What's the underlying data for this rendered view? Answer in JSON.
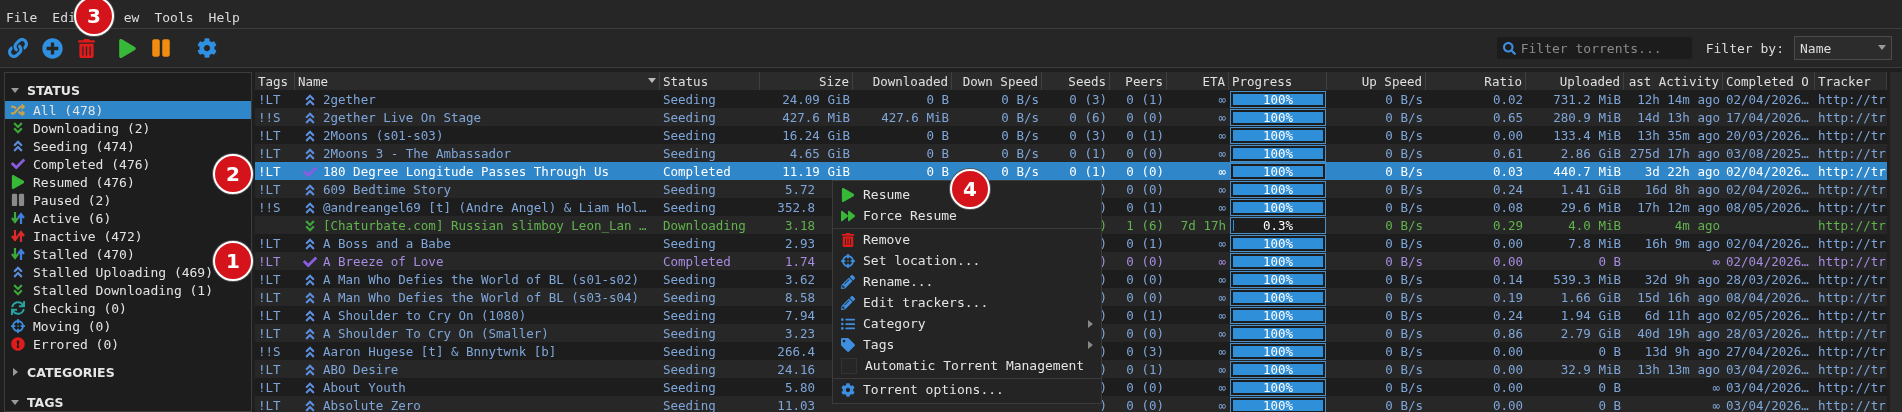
{
  "menu_bar": [
    {
      "label": "File"
    },
    {
      "label": "Edi"
    },
    {
      "label": "ew"
    },
    {
      "label": "Tools"
    },
    {
      "label": "Help"
    }
  ],
  "toolbar": {
    "buttons": [
      {
        "kind": "link"
      },
      {
        "kind": "add"
      },
      {
        "kind": "delete"
      },
      {
        "kind": "play"
      },
      {
        "kind": "pause"
      },
      {
        "kind": "settings"
      }
    ],
    "search": {
      "placeholder": "Filter torrents..."
    },
    "filter_label": "Filter by:",
    "filter_value": "Name"
  },
  "sidebar": {
    "sections": [
      {
        "title": "STATUS",
        "expanded": true,
        "items": [
          {
            "label": "All (478)",
            "kind": "all",
            "selected": true
          },
          {
            "label": "Downloading (2)",
            "kind": "downloading",
            "selected": false
          },
          {
            "label": "Seeding (474)",
            "kind": "seeding",
            "selected": false
          },
          {
            "label": "Completed (476)",
            "kind": "completed",
            "selected": false
          },
          {
            "label": "Resumed (476)",
            "kind": "resumed",
            "selected": false
          },
          {
            "label": "Paused (2)",
            "kind": "paused",
            "selected": false
          },
          {
            "label": "Active (6)",
            "kind": "active",
            "selected": false
          },
          {
            "label": "Inactive (472)",
            "kind": "inactive",
            "selected": false
          },
          {
            "label": "Stalled (470)",
            "kind": "stalled",
            "selected": false
          },
          {
            "label": "Stalled Uploading (469)",
            "kind": "stalledup",
            "selected": false
          },
          {
            "label": "Stalled Downloading (1)",
            "kind": "stalleddown",
            "selected": false
          },
          {
            "label": "Checking (0)",
            "kind": "checking",
            "selected": false
          },
          {
            "label": "Moving (0)",
            "kind": "moving",
            "selected": false
          },
          {
            "label": "Errored (0)",
            "kind": "errored",
            "selected": false
          }
        ]
      },
      {
        "title": "CATEGORIES",
        "expanded": false
      },
      {
        "title": "TAGS",
        "expanded": true
      }
    ]
  },
  "table": {
    "columns": [
      "Tags",
      "Name",
      "Status",
      "Size",
      "Downloaded",
      "Down Speed",
      "Seeds",
      "Peers",
      "ETA",
      "Progress",
      "Up Speed",
      "Ratio",
      "Uploaded",
      "ast Activity",
      "Completed O",
      "Tracker"
    ],
    "rows": [
      {
        "tags": "!LT",
        "name": "2gether",
        "status": "Seeding",
        "kind": "seeding",
        "selected": false,
        "size": "24.09 GiB",
        "downloaded": "0 B",
        "down_speed": "0 B/s",
        "seeds": "0 (3)",
        "peers": "0 (1)",
        "eta": "∞",
        "progress": "100%",
        "level": 1,
        "up_speed": "0 B/s",
        "ratio": "0.02",
        "uploaded": "731.2 MiB",
        "last_activity": "12h 14m ago",
        "completed_on": "02/04/2026…",
        "tracker": "http://tr"
      },
      {
        "tags": "!!S",
        "name": "2gether Live On Stage",
        "status": "Seeding",
        "kind": "seeding",
        "selected": false,
        "size": "427.6 MiB",
        "downloaded": "427.6 MiB",
        "down_speed": "0 B/s",
        "seeds": "0 (6)",
        "peers": "0 (0)",
        "eta": "∞",
        "progress": "100%",
        "level": 1,
        "up_speed": "0 B/s",
        "ratio": "0.65",
        "uploaded": "280.9 MiB",
        "last_activity": "14d 13h ago",
        "completed_on": "17/04/2026…",
        "tracker": "http://tr"
      },
      {
        "tags": "!LT",
        "name": "2Moons (s01-s03)",
        "status": "Seeding",
        "kind": "seeding",
        "selected": false,
        "size": "16.24 GiB",
        "downloaded": "0 B",
        "down_speed": "0 B/s",
        "seeds": "0 (3)",
        "peers": "0 (1)",
        "eta": "∞",
        "progress": "100%",
        "level": 1,
        "up_speed": "0 B/s",
        "ratio": "0.00",
        "uploaded": "133.4 MiB",
        "last_activity": "13h 35m ago",
        "completed_on": "20/03/2026…",
        "tracker": "http://tr"
      },
      {
        "tags": "!LT",
        "name": "2Moons 3 - The Ambassador",
        "status": "Seeding",
        "kind": "seeding",
        "selected": false,
        "size": "4.65 GiB",
        "downloaded": "0 B",
        "down_speed": "0 B/s",
        "seeds": "0 (1)",
        "peers": "0 (0)",
        "eta": "∞",
        "progress": "100%",
        "level": 1,
        "up_speed": "0 B/s",
        "ratio": "0.61",
        "uploaded": "2.86 GiB",
        "last_activity": "275d 17h ago",
        "completed_on": "03/08/2025…",
        "tracker": "http://tr"
      },
      {
        "tags": "!LT",
        "name": "180 Degree Longitude Passes Through Us",
        "status": "Completed",
        "kind": "completed",
        "selected": true,
        "size": "11.19 GiB",
        "downloaded": "0 B",
        "down_speed": "0 B/s",
        "seeds": "0 (1)",
        "peers": "0 (0)",
        "eta": "∞",
        "progress": "100%",
        "level": 1,
        "up_speed": "0 B/s",
        "ratio": "0.03",
        "uploaded": "440.7 MiB",
        "last_activity": "3d 22h ago",
        "completed_on": "02/04/2026…",
        "tracker": "http://tr"
      },
      {
        "tags": "!LT",
        "name": "609 Bedtime Story",
        "status": "Seeding",
        "kind": "seeding",
        "selected": false,
        "size": "5.72",
        "seeds": ")",
        "peers": "0 (0)",
        "eta": "∞",
        "progress": "100%",
        "level": 1,
        "up_speed": "0 B/s",
        "ratio": "0.24",
        "uploaded": "1.41 GiB",
        "last_activity": "16d 8h ago",
        "completed_on": "02/04/2026…",
        "tracker": "http://tr"
      },
      {
        "tags": "!!S",
        "name": "@andreangel69 [t] (Andre Angel) & Liam Hol…",
        "status": "Seeding",
        "kind": "seeding",
        "selected": false,
        "size": "352.8",
        "seeds": ")",
        "peers": "0 (1)",
        "eta": "∞",
        "progress": "100%",
        "level": 1,
        "up_speed": "0 B/s",
        "ratio": "0.08",
        "uploaded": "29.6 MiB",
        "last_activity": "17h 12m ago",
        "completed_on": "08/05/2026…",
        "tracker": "http://tr"
      },
      {
        "name": "[Chaturbate.com] Russian slimboy Leon_Lan …",
        "status": "Downloading",
        "kind": "downloading",
        "selected": false,
        "size": "3.18",
        "seeds": ")",
        "peers": "1 (6)",
        "eta": "7d 17h",
        "progress": "0.3%",
        "level": 0.003,
        "up_speed": "0 B/s",
        "ratio": "0.29",
        "uploaded": "4.0 MiB",
        "last_activity": "4m ago",
        "tracker": "http://tr"
      },
      {
        "tags": "!LT",
        "name": "A Boss and a Babe",
        "status": "Seeding",
        "kind": "seeding",
        "selected": false,
        "size": "2.93",
        "seeds": ")",
        "peers": "0 (1)",
        "eta": "∞",
        "progress": "100%",
        "level": 1,
        "up_speed": "0 B/s",
        "ratio": "0.00",
        "uploaded": "7.8 MiB",
        "last_activity": "16h 9m ago",
        "completed_on": "02/04/2026…",
        "tracker": "http://tr"
      },
      {
        "tags": "!LT",
        "name": "A Breeze of Love",
        "status": "Completed",
        "kind": "completed",
        "selected": false,
        "size": "1.74",
        "seeds": ")",
        "peers": "0 (0)",
        "eta": "∞",
        "progress": "100%",
        "level": 1,
        "up_speed": "0 B/s",
        "ratio": "0.00",
        "uploaded": "0 B",
        "last_activity": "∞",
        "completed_on": "02/04/2026…",
        "tracker": "http://tr"
      },
      {
        "tags": "!LT",
        "name": "A Man Who Defies the World of BL (s01-s02)",
        "status": "Seeding",
        "kind": "seeding",
        "selected": false,
        "size": "3.62",
        "seeds": ")",
        "peers": "0 (0)",
        "eta": "∞",
        "progress": "100%",
        "level": 1,
        "up_speed": "0 B/s",
        "ratio": "0.14",
        "uploaded": "539.3 MiB",
        "last_activity": "32d 9h ago",
        "completed_on": "28/03/2026…",
        "tracker": "http://tr"
      },
      {
        "tags": "!LT",
        "name": "A Man Who Defies the World of BL (s03-s04)",
        "status": "Seeding",
        "kind": "seeding",
        "selected": false,
        "size": "8.58",
        "seeds": ")",
        "peers": "0 (0)",
        "eta": "∞",
        "progress": "100%",
        "level": 1,
        "up_speed": "0 B/s",
        "ratio": "0.19",
        "uploaded": "1.66 GiB",
        "last_activity": "15d 16h ago",
        "completed_on": "08/04/2026…",
        "tracker": "http://tr"
      },
      {
        "tags": "!LT",
        "name": "A Shoulder to Cry On (1080)",
        "status": "Seeding",
        "kind": "seeding",
        "selected": false,
        "size": "7.94",
        "seeds": ")",
        "peers": "0 (1)",
        "eta": "∞",
        "progress": "100%",
        "level": 1,
        "up_speed": "0 B/s",
        "ratio": "0.24",
        "uploaded": "1.94 GiB",
        "last_activity": "6d 11h ago",
        "completed_on": "02/05/2026…",
        "tracker": "http://tr"
      },
      {
        "tags": "!LT",
        "name": "A Shoulder To Cry On (Smaller)",
        "status": "Seeding",
        "kind": "seeding",
        "selected": false,
        "size": "3.23",
        "seeds": ")",
        "peers": "0 (0)",
        "eta": "∞",
        "progress": "100%",
        "level": 1,
        "up_speed": "0 B/s",
        "ratio": "0.86",
        "uploaded": "2.79 GiB",
        "last_activity": "40d 19h ago",
        "completed_on": "28/03/2026…",
        "tracker": "http://tr"
      },
      {
        "tags": "!!S",
        "name": "Aaron Hugese [t] & Bnnytwnk [b]",
        "status": "Seeding",
        "kind": "seeding",
        "selected": false,
        "size": "266.4",
        "seeds": ")",
        "peers": "0 (3)",
        "eta": "∞",
        "progress": "100%",
        "level": 1,
        "up_speed": "0 B/s",
        "ratio": "0.00",
        "uploaded": "0 B",
        "last_activity": "13d 9h ago",
        "completed_on": "27/04/2026…",
        "tracker": "http://tr"
      },
      {
        "tags": "!LT",
        "name": "ABO Desire",
        "status": "Seeding",
        "kind": "seeding",
        "selected": false,
        "size": "24.16",
        "seeds": ")",
        "peers": "0 (1)",
        "eta": "∞",
        "progress": "100%",
        "level": 1,
        "up_speed": "0 B/s",
        "ratio": "0.00",
        "uploaded": "32.9 MiB",
        "last_activity": "13h 13m ago",
        "completed_on": "03/04/2026…",
        "tracker": "http://tr"
      },
      {
        "tags": "!LT",
        "name": "About Youth",
        "status": "Seeding",
        "kind": "seeding",
        "selected": false,
        "size": "5.80",
        "seeds": ")",
        "peers": "0 (0)",
        "eta": "∞",
        "progress": "100%",
        "level": 1,
        "up_speed": "0 B/s",
        "ratio": "0.00",
        "uploaded": "0 B",
        "last_activity": "∞",
        "completed_on": "03/04/2026…",
        "tracker": "http://tr"
      },
      {
        "tags": "!LT",
        "name": "Absolute Zero",
        "status": "Seeding",
        "kind": "seeding",
        "selected": false,
        "size": "11.03",
        "seeds": ")",
        "peers": "0 (0)",
        "eta": "∞",
        "progress": "100%",
        "level": 1,
        "up_speed": "0 B/s",
        "ratio": "0.00",
        "uploaded": "0 B",
        "last_activity": "∞",
        "completed_on": "03/04/2026…",
        "tracker": "http://tr"
      }
    ]
  },
  "context_menu": {
    "items": [
      {
        "label": "Resume",
        "kind": "resume"
      },
      {
        "label": "Force Resume",
        "kind": "force"
      },
      {
        "label": "Remove",
        "kind": "remove",
        "separator_before": true
      },
      {
        "label": "Set location...",
        "kind": "location"
      },
      {
        "label": "Rename...",
        "kind": "rename"
      },
      {
        "label": "Edit trackers...",
        "kind": "edit"
      },
      {
        "label": "Category",
        "kind": "category",
        "submenu": true
      },
      {
        "label": "Tags",
        "kind": "tags",
        "submenu": true
      },
      {
        "label": "Automatic Torrent Management",
        "kind": "checkbox",
        "checked": false
      },
      {
        "label": "Torrent options...",
        "kind": "options",
        "separator_before": true
      }
    ]
  },
  "annotations": [
    {
      "label": "1"
    },
    {
      "label": "2"
    },
    {
      "label": "3"
    },
    {
      "label": "4"
    }
  ]
}
